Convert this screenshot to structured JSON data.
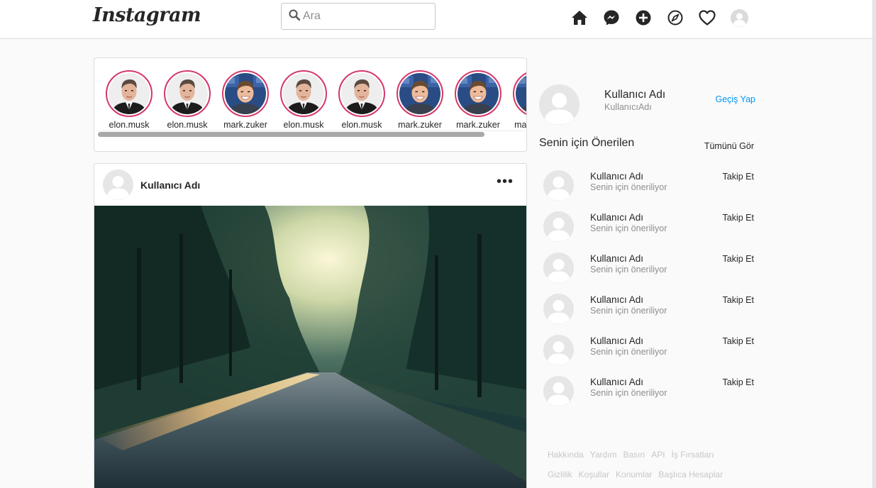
{
  "nav": {
    "logo": "Instagram",
    "search_placeholder": "Ara",
    "icons": [
      "home-icon",
      "messenger-icon",
      "new-post-icon",
      "explore-icon",
      "activity-heart-icon",
      "profile-avatar"
    ]
  },
  "stories": [
    {
      "name": "elon.musk",
      "person": "elon"
    },
    {
      "name": "elon.musk",
      "person": "elon"
    },
    {
      "name": "mark.zuker",
      "person": "mark"
    },
    {
      "name": "elon.musk",
      "person": "elon"
    },
    {
      "name": "elon.musk",
      "person": "elon"
    },
    {
      "name": "mark.zuker",
      "person": "mark"
    },
    {
      "name": "mark.zuker",
      "person": "mark"
    },
    {
      "name": "mark.zuker",
      "person": "mark"
    }
  ],
  "post": {
    "username": "Kullanıcı Adı",
    "more": "•••"
  },
  "sidebar": {
    "me": {
      "name": "Kullanıcı Adı",
      "handle": "KullanıcıAdı",
      "switch_label": "Geçiş Yap"
    },
    "suggest_title": "Senin için Önerilen",
    "see_all": "Tümünü Gör",
    "suggestions": [
      {
        "name": "Kullanıcı Adı",
        "sub": "Senin için öneriliyor",
        "action": "Takip Et"
      },
      {
        "name": "Kullanıcı Adı",
        "sub": "Senin için öneriliyor",
        "action": "Takip Et"
      },
      {
        "name": "Kullanıcı Adı",
        "sub": "Senin için öneriliyor",
        "action": "Takip Et"
      },
      {
        "name": "Kullanıcı Adı",
        "sub": "Senin için öneriliyor",
        "action": "Takip Et"
      },
      {
        "name": "Kullanıcı Adı",
        "sub": "Senin için öneriliyor",
        "action": "Takip Et"
      },
      {
        "name": "Kullanıcı Adı",
        "sub": "Senin için öneriliyor",
        "action": "Takip Et"
      }
    ],
    "footer": [
      [
        "Hakkında",
        "Yardım",
        "Basın",
        "API",
        "İş Fırsatları"
      ],
      [
        "Gizlilik",
        "Koşullar",
        "Konumlar",
        "Başlıca Hesaplar"
      ]
    ]
  },
  "colors": {
    "link_blue": "#0095f6",
    "story_ring": "#d6386a",
    "muted_text": "#8e8e8e",
    "border": "#dbdbdb"
  }
}
